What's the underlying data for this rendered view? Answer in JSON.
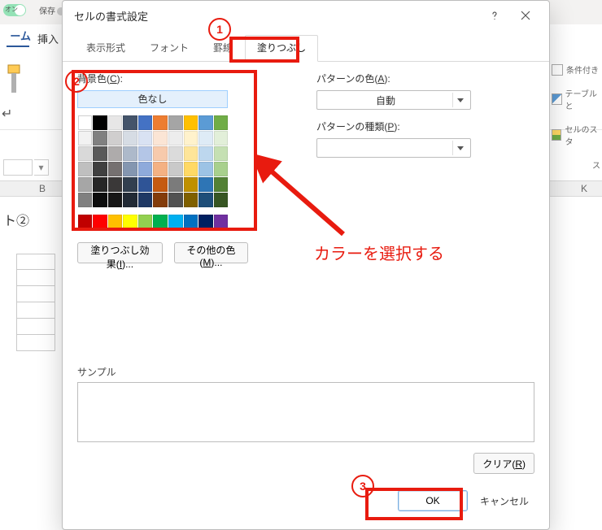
{
  "bg": {
    "toggle_label": "オン",
    "save_text": "保存",
    "tab_home": "ーム",
    "tab_insert": "挿入",
    "sheet_fragment": "ト②",
    "col_B": "B",
    "col_K": "K",
    "right_items": [
      "条件付き",
      "テーブルと",
      "セルのスタ",
      "ス"
    ]
  },
  "dialog": {
    "title": "セルの書式設定",
    "tabs": {
      "number": "表示形式",
      "font": "フォント",
      "border": "罫線",
      "fill": "塗りつぶし"
    }
  },
  "fill": {
    "bg_color_label_pre": "背景色(",
    "bg_color_label_key": "C",
    "bg_color_label_post": "):",
    "no_color": "色なし",
    "effects_pre": "塗りつぶし効果(",
    "effects_key": "I",
    "effects_post": ")...",
    "more_pre": "その他の色(",
    "more_key": "M",
    "more_post": ")...",
    "pattern_color_pre": "パターンの色(",
    "pattern_color_key": "A",
    "pattern_color_post": "):",
    "pattern_color_auto": "自動",
    "pattern_type_pre": "パターンの種類(",
    "pattern_type_key": "P",
    "pattern_type_post": "):"
  },
  "sample": {
    "label": "サンプル"
  },
  "buttons": {
    "clear_pre": "クリア(",
    "clear_key": "R",
    "clear_post": ")",
    "ok": "OK",
    "cancel": "キャンセル"
  },
  "annotations": {
    "c1": "1",
    "c2": "2",
    "c3": "3",
    "hint": "カラーを選択する"
  },
  "palette": {
    "row0": [
      "#ffffff",
      "#000000",
      "#e7e6e6",
      "#44546a",
      "#4472c4",
      "#ed7d31",
      "#a5a5a5",
      "#ffc000",
      "#5b9bd5",
      "#70ad47"
    ],
    "row1": [
      "#f2f2f2",
      "#808080",
      "#d0cece",
      "#d6dce4",
      "#d9e2f3",
      "#fbe5d5",
      "#ededed",
      "#fff2cc",
      "#deebf6",
      "#e2efd9"
    ],
    "row2": [
      "#d9d9d9",
      "#595959",
      "#aeabab",
      "#adb9ca",
      "#b4c6e7",
      "#f7caac",
      "#dbdbdb",
      "#fee599",
      "#bdd7ee",
      "#c5e0b3"
    ],
    "row3": [
      "#bfbfbf",
      "#404040",
      "#757070",
      "#8496b0",
      "#8eaadb",
      "#f4b183",
      "#c9c9c9",
      "#ffd965",
      "#9cc3e5",
      "#a8d08d"
    ],
    "row4": [
      "#a6a6a6",
      "#262626",
      "#3a3838",
      "#323f4f",
      "#2f5496",
      "#c55a11",
      "#7b7b7b",
      "#bf9000",
      "#2e75b5",
      "#538135"
    ],
    "row5": [
      "#808080",
      "#0d0d0d",
      "#171616",
      "#222a35",
      "#1f3864",
      "#833c0b",
      "#525252",
      "#7f6000",
      "#1e4e79",
      "#375623"
    ],
    "std": [
      "#c00000",
      "#ff0000",
      "#ffc000",
      "#ffff00",
      "#92d050",
      "#00b050",
      "#00b0f0",
      "#0070c0",
      "#002060",
      "#7030a0"
    ]
  }
}
